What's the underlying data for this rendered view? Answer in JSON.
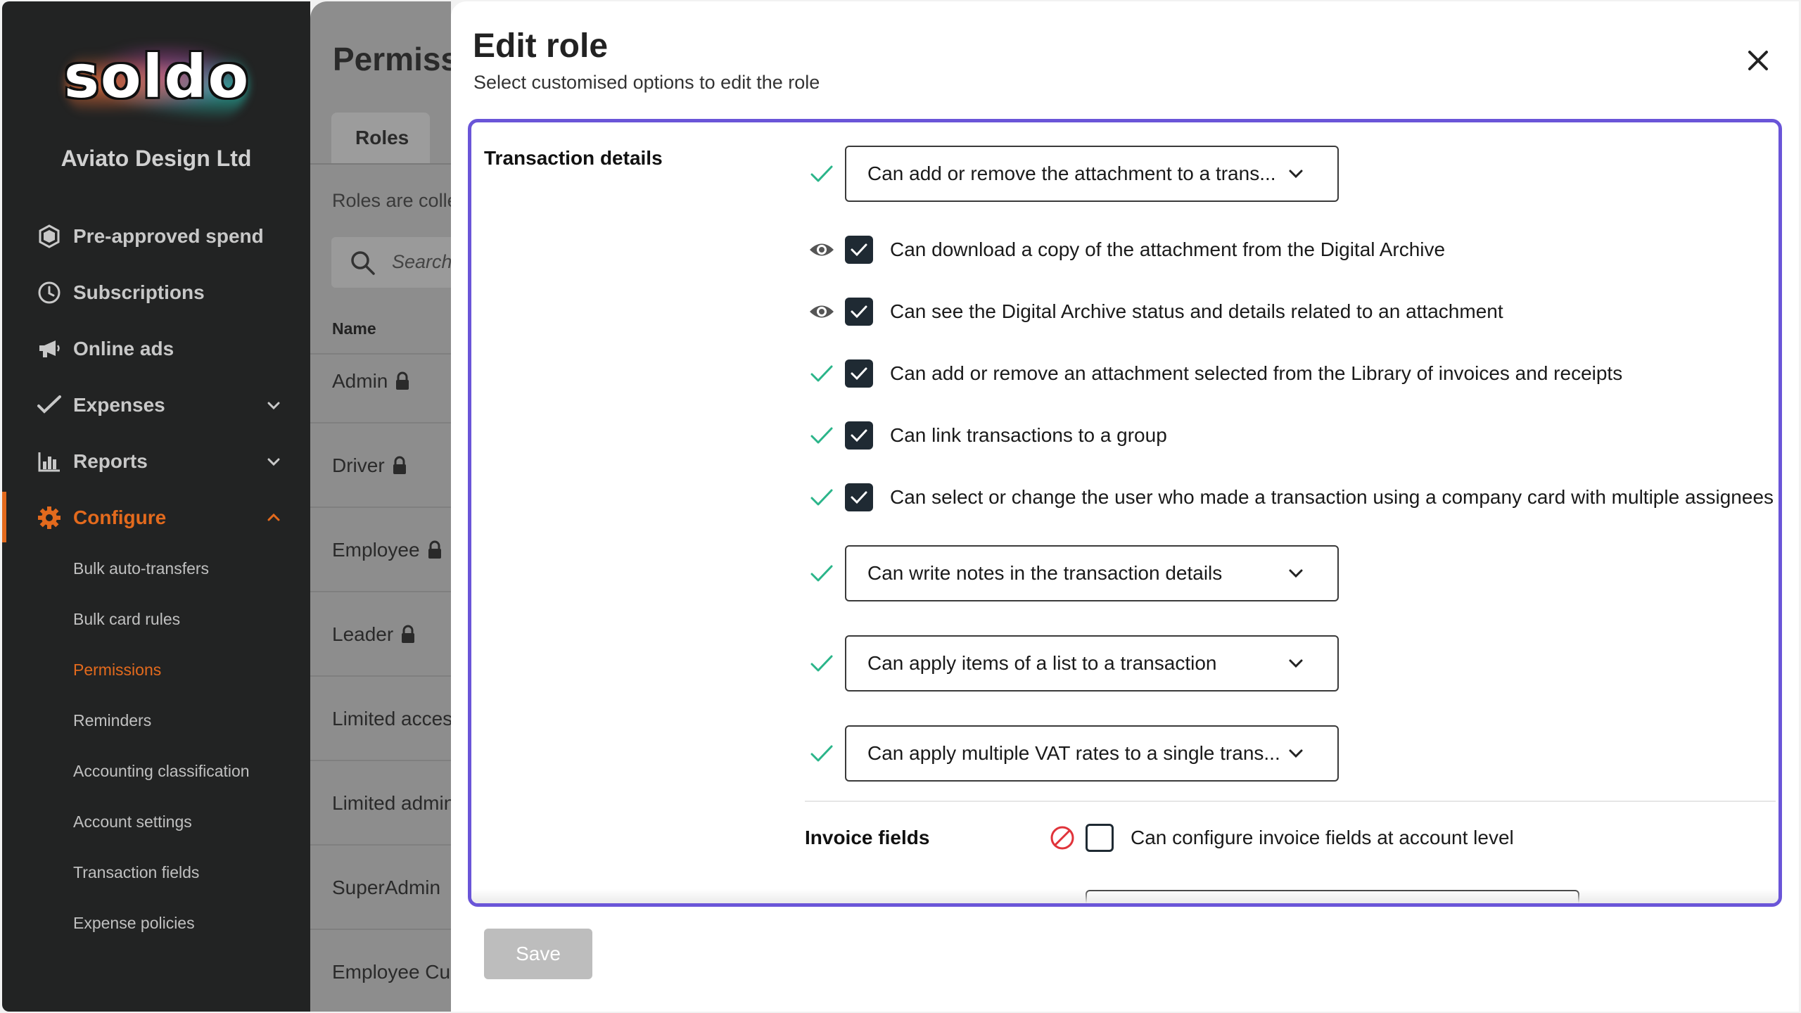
{
  "sidebar": {
    "logo_text": "soldo",
    "company": "Aviato Design Ltd",
    "nav": [
      {
        "label": "Pre-approved spend",
        "icon": "hexagon-shield-icon"
      },
      {
        "label": "Subscriptions",
        "icon": "clock-icon"
      },
      {
        "label": "Online ads",
        "icon": "megaphone-icon"
      },
      {
        "label": "Expenses",
        "icon": "check-pen-icon"
      },
      {
        "label": "Reports",
        "icon": "bar-chart-icon"
      },
      {
        "label": "Configure",
        "icon": "gear-icon"
      }
    ],
    "sub_items": [
      "Bulk auto-transfers",
      "Bulk card rules",
      "Permissions",
      "Reminders",
      "Accounting classification",
      "Account settings",
      "Transaction fields",
      "Expense policies"
    ],
    "accent_color": "#e36a1d"
  },
  "background_page": {
    "title": "Permissions",
    "tab": "Roles",
    "subtitle": "Roles are collections",
    "search_placeholder": "Search",
    "column_header": "Name",
    "rows": [
      "Admin",
      "Driver",
      "Employee",
      "Leader",
      "Limited access",
      "Limited admin",
      "SuperAdmin",
      "Employee Custom"
    ]
  },
  "modal": {
    "title": "Edit role",
    "subtitle": "Select customised options to edit the role",
    "section_title": "Transaction details",
    "selects": [
      "Can add or remove the attachment to a trans...",
      "Can write notes in the transaction details",
      "Can apply items of a list to a transaction",
      "Can apply multiple VAT rates to a single trans..."
    ],
    "checkboxes": [
      {
        "label": "Can download a copy of the attachment from the Digital Archive",
        "checked": true,
        "status": "eye-icon"
      },
      {
        "label": "Can see the Digital Archive status and details related to an attachment",
        "checked": true,
        "status": "eye-icon"
      },
      {
        "label": "Can add or remove an attachment selected from the Library of invoices and receipts",
        "checked": true,
        "status": "check-icon"
      },
      {
        "label": "Can link transactions to a group",
        "checked": true,
        "status": "check-icon"
      },
      {
        "label": "Can select or change the user who made a transaction using a company card with multiple assignees",
        "checked": true,
        "status": "check-icon"
      }
    ],
    "invoice": {
      "title": "Invoice fields",
      "label": "Can configure invoice fields at account level",
      "checked": false,
      "status": "blocked-icon"
    },
    "save_label": "Save",
    "panel_border_color": "#6a55d8",
    "check_color": "#2bb58a",
    "blocked_color": "#e0333a"
  }
}
